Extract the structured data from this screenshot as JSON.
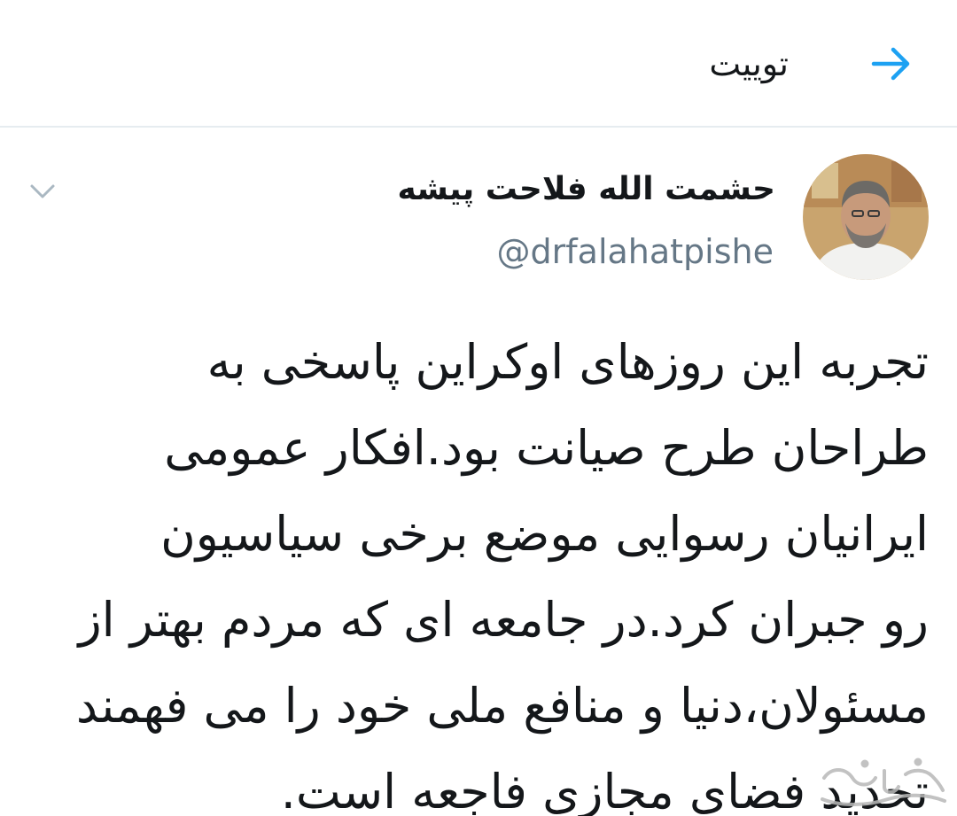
{
  "header": {
    "title": "توییت",
    "back_icon": "arrow-right-icon"
  },
  "tweet": {
    "author": {
      "display_name": "حشمت الله فلاحت پیشه",
      "handle": "@drfalahatpishe",
      "avatar": "avatar-photo"
    },
    "menu_icon": "chevron-down-icon",
    "text_lines": [
      "تجربه این روزهای اوکراین پاسخی به",
      "طراحان طرح صیانت بود.افکار عمومی",
      "ایرانیان رسوایی موضع برخی سیاسیون",
      "رو جبران کرد.در جامعه ای که مردم بهتر از",
      "مسئولان،دنیا و منافع ملی خود را می فهمند",
      "تحدید فضای مجازی فاجعه است."
    ]
  },
  "colors": {
    "accent": "#1da1f2",
    "text": "#14171a",
    "secondary_text": "#657786",
    "divider": "#e6ecf0"
  }
}
